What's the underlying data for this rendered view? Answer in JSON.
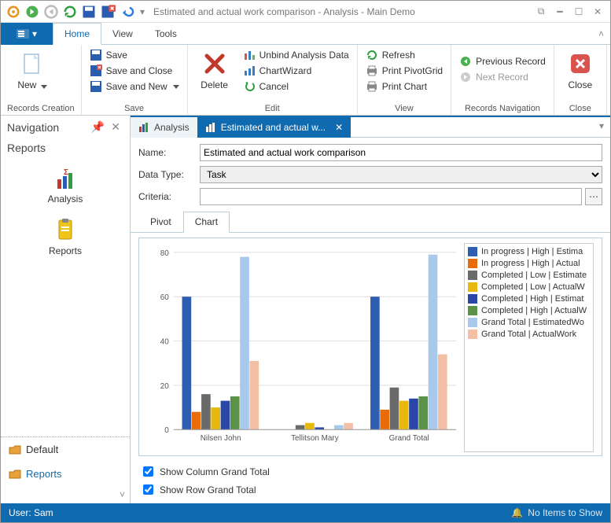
{
  "title": "Estimated and actual work comparison - Analysis - Main Demo",
  "ribbonTabs": {
    "home": "Home",
    "view": "View",
    "tools": "Tools"
  },
  "ribbon": {
    "new": "New",
    "save": "Save",
    "saveClose": "Save and Close",
    "saveNew": "Save and New",
    "delete": "Delete",
    "unbind": "Unbind Analysis Data",
    "wizard": "ChartWizard",
    "cancel": "Cancel",
    "refresh": "Refresh",
    "pivotGrid": "Print PivotGrid",
    "printChart": "Print Chart",
    "prev": "Previous Record",
    "next": "Next Record",
    "close": "Close",
    "g1": "Records Creation",
    "g2": "Save",
    "g3": "Edit",
    "g4": "View",
    "g5": "Records Navigation",
    "g6": "Close"
  },
  "nav": {
    "title": "Navigation",
    "section": "Reports",
    "analysis": "Analysis",
    "reports": "Reports",
    "default": "Default",
    "reportsAcc": "Reports"
  },
  "doctabs": {
    "analysis": "Analysis",
    "current": "Estimated and actual w..."
  },
  "form": {
    "nameLbl": "Name:",
    "name": "Estimated and actual work comparison",
    "typeLbl": "Data Type:",
    "type": "Task",
    "critLbl": "Criteria:",
    "crit": ""
  },
  "subtabs": {
    "pivot": "Pivot",
    "chart": "Chart"
  },
  "checks": {
    "col": "Show Column Grand Total",
    "row": "Show Row Grand Total"
  },
  "status": {
    "user": "User: Sam",
    "right": "No Items to Show"
  },
  "chart_data": {
    "type": "bar",
    "categories": [
      "Nilsen John",
      "Tellitson Mary",
      "Grand Total"
    ],
    "ylim": [
      0,
      80
    ],
    "series": [
      {
        "name": "In progress | High | Estima",
        "color": "#2f5eb0",
        "values": [
          60,
          0,
          60
        ]
      },
      {
        "name": "In progress | High | Actual",
        "color": "#e86c0a",
        "values": [
          8,
          0,
          9
        ]
      },
      {
        "name": "Completed | Low | Estimate",
        "color": "#6a6a6a",
        "values": [
          16,
          2,
          19
        ]
      },
      {
        "name": "Completed | Low | ActualW",
        "color": "#e7b90e",
        "values": [
          10,
          3,
          13
        ]
      },
      {
        "name": "Completed | High | Estimat",
        "color": "#2946a8",
        "values": [
          13,
          1,
          14
        ]
      },
      {
        "name": "Completed | High | ActualW",
        "color": "#5a9348",
        "values": [
          15,
          0,
          15
        ]
      },
      {
        "name": "Grand Total | EstimatedWo",
        "color": "#a9c9ec",
        "values": [
          78,
          2,
          79
        ]
      },
      {
        "name": "Grand Total | ActualWork",
        "color": "#f3c0a5",
        "values": [
          31,
          3,
          34
        ]
      }
    ]
  }
}
